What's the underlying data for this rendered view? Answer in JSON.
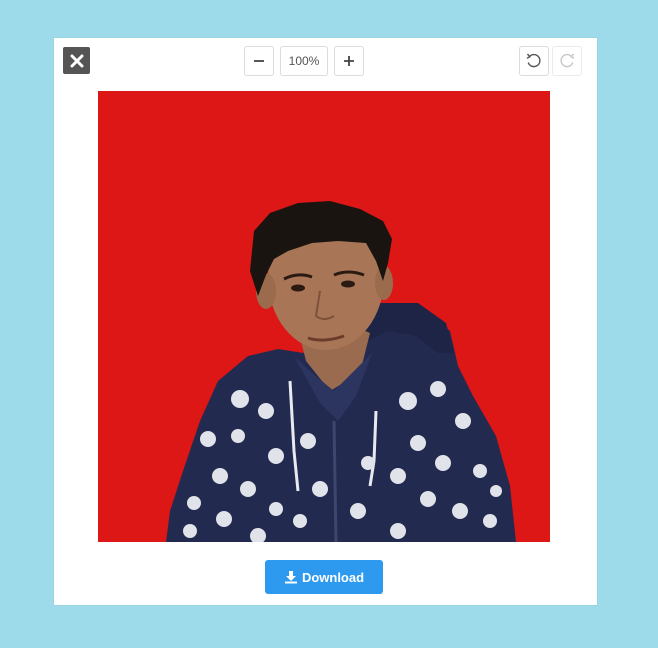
{
  "toolbar": {
    "zoom_label": "100%"
  },
  "actions": {
    "download_label": "Download"
  },
  "icons": {
    "close": "close-icon",
    "zoom_out": "minus-icon",
    "zoom_in": "plus-icon",
    "undo": "rotate-left-icon",
    "redo": "rotate-right-icon",
    "download": "download-icon"
  },
  "colors": {
    "page_background": "#9ddbea",
    "photo_background": "#dd1616",
    "download_button": "#2d9af0",
    "close_button": "#555555"
  }
}
